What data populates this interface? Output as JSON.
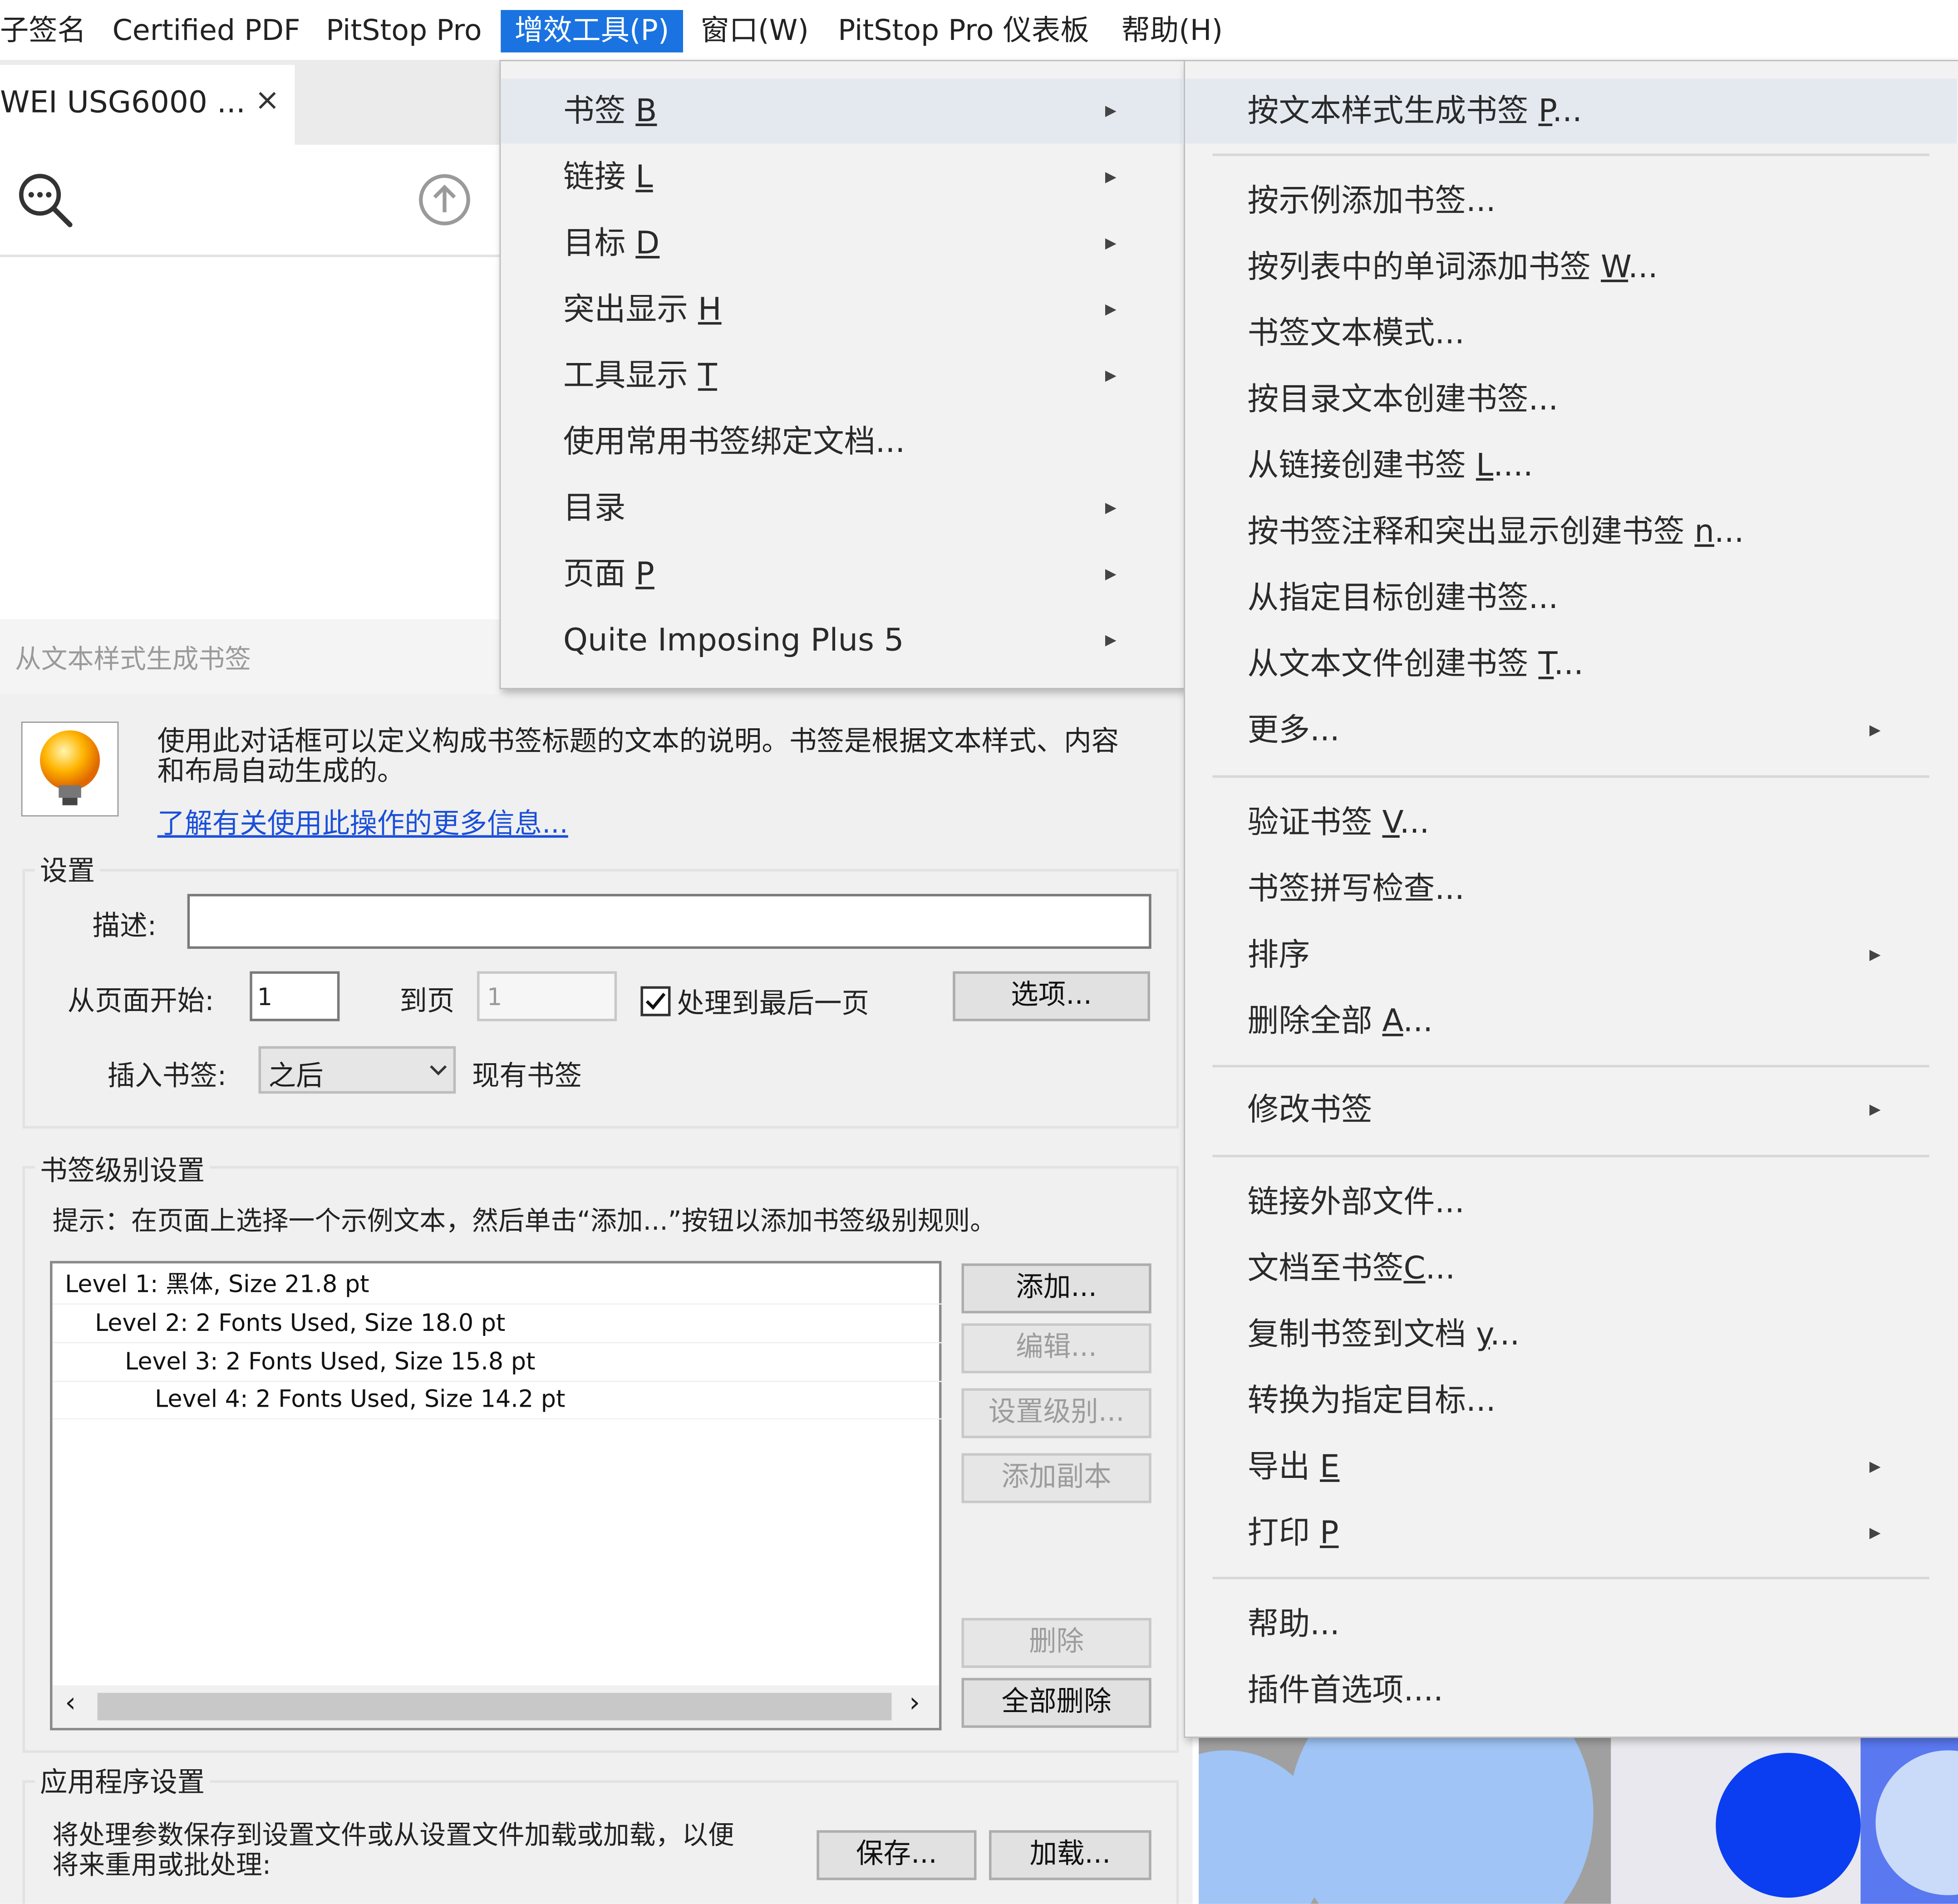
{
  "menubar": {
    "items": [
      "子签名",
      "Certified PDF",
      "PitStop Pro",
      "增效工具(P)",
      "窗口(W)",
      "PitStop Pro 仪表板",
      "帮助(H)"
    ]
  },
  "doc_tab": {
    "title": "WEI USG6000 ...",
    "close": "×"
  },
  "plugins_menu": {
    "items": [
      {
        "label": "书签 ",
        "key": "B"
      },
      {
        "label": "链接 ",
        "key": "L"
      },
      {
        "label": "目标 ",
        "key": "D"
      },
      {
        "label": "突出显示 ",
        "key": "H"
      },
      {
        "label": "工具显示 ",
        "key": "T"
      },
      {
        "label": "使用常用书签绑定文档...",
        "key": ""
      },
      {
        "label": "目录",
        "key": ""
      },
      {
        "label": "页面 ",
        "key": "P"
      },
      {
        "label": "Quite Imposing Plus 5",
        "key": ""
      }
    ]
  },
  "bookmark_menu": {
    "items": [
      {
        "label": "按文本样式生成书签 ",
        "key": "P",
        "suffix": "..."
      },
      {
        "label": "按示例添加书签...",
        "key": "",
        "suffix": ""
      },
      {
        "label": "按列表中的单词添加书签 ",
        "key": "W",
        "suffix": "..."
      },
      {
        "label": "书签文本模式...",
        "key": "",
        "suffix": ""
      },
      {
        "label": "按目录文本创建书签...",
        "key": "",
        "suffix": ""
      },
      {
        "label": "从链接创建书签 ",
        "key": "L",
        "suffix": "...."
      },
      {
        "label": "按书签注释和突出显示创建书签 ",
        "key": "n",
        "suffix": "..."
      },
      {
        "label": "从指定目标创建书签...",
        "key": "",
        "suffix": ""
      },
      {
        "label": "从文本文件创建书签 ",
        "key": "T",
        "suffix": "..."
      },
      {
        "label": "更多...",
        "key": "",
        "suffix": ""
      },
      {
        "label": "验证书签 ",
        "key": "V",
        "suffix": "..."
      },
      {
        "label": "书签拼写检查...",
        "key": "",
        "suffix": ""
      },
      {
        "label": "排序",
        "key": "",
        "suffix": ""
      },
      {
        "label": "删除全部 ",
        "key": "A",
        "suffix": "..."
      },
      {
        "label": "修改书签",
        "key": "",
        "suffix": ""
      },
      {
        "label": "链接外部文件...",
        "key": "",
        "suffix": ""
      },
      {
        "label": "文档至书签",
        "key": "C",
        "suffix": "..."
      },
      {
        "label": "复制书签到文档 ",
        "key": "y",
        "suffix": "..."
      },
      {
        "label": "转换为指定目标...",
        "key": "",
        "suffix": ""
      },
      {
        "label": "导出 ",
        "key": "E",
        "suffix": ""
      },
      {
        "label": "打印 ",
        "key": "P",
        "suffix": ""
      },
      {
        "label": "帮助...",
        "key": "",
        "suffix": ""
      },
      {
        "label": "插件首选项....",
        "key": "",
        "suffix": ""
      }
    ]
  },
  "dialog": {
    "title": "从文本样式生成书签",
    "intro_line1": "使用此对话框可以定义构成书签标题的文本的说明。书签是根据文本样式、内容",
    "intro_line2": "和布局自动生成的。",
    "learn_more": "了解有关使用此操作的更多信息...",
    "settings_legend": "设置",
    "desc_label": "描述:",
    "desc_value": "",
    "from_page_label": "从页面开始:",
    "from_page_value": "1",
    "to_page_label": "到页",
    "to_page_value": "1",
    "process_last_label": "处理到最后一页",
    "process_last_checked": true,
    "options_button": "选项...",
    "insert_label": "插入书签:",
    "insert_value": "之后",
    "existing_label": "现有书签",
    "levels_legend": "书签级别设置",
    "hint": "提示：在页面上选择一个示例文本，然后单击“添加...”按钮以添加书签级别规则。",
    "levels": [
      "Level 1: 黑体, Size 21.8 pt",
      "Level 2: 2 Fonts Used, Size 18.0 pt",
      "Level 3: 2 Fonts Used, Size 15.8 pt",
      "Level 4: 2 Fonts Used, Size 14.2 pt"
    ],
    "add_button": "添加...",
    "edit_button": "编辑...",
    "set_level_button": "设置级别...",
    "add_copy_button": "添加副本",
    "delete_button": "删除",
    "delete_all_button": "全部删除",
    "app_legend": "应用程序设置",
    "app_text_line1": "将处理参数保存到设置文件或从设置文件加载或加载，以便",
    "app_text_line2": "将来重用或批处理:",
    "save_button": "保存...",
    "load_button": "加载..."
  },
  "colors": {
    "menu_active": "#1a73e0",
    "link": "#1a4fd8",
    "circle_blue": "#0a3ef0",
    "circle_light": "#9fc4f5"
  }
}
